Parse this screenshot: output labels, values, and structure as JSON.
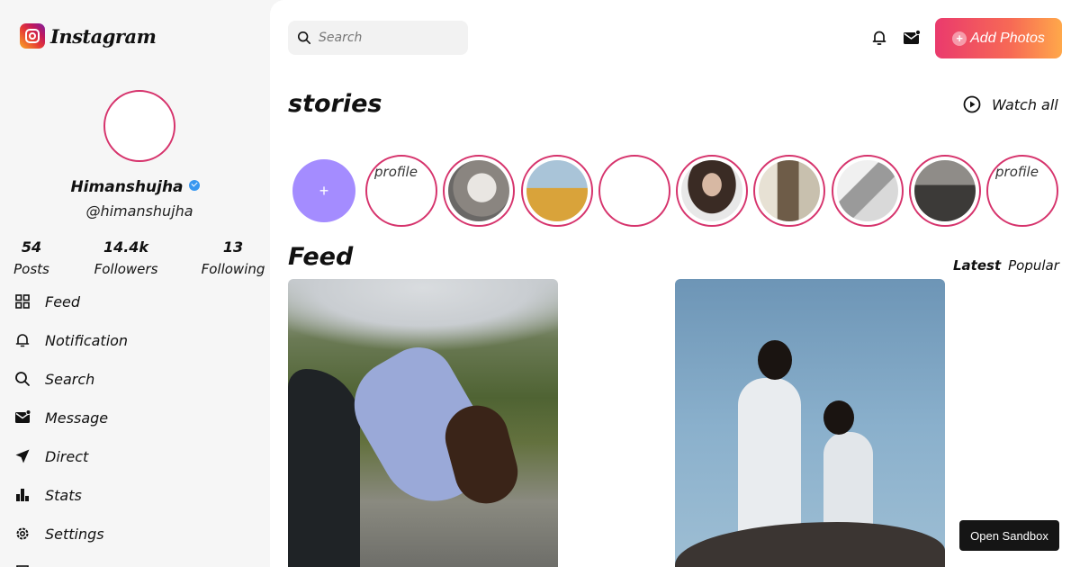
{
  "app": {
    "logo_text": "Instagram"
  },
  "profile": {
    "name": "Himanshujha",
    "handle": "@himanshujha",
    "stats": [
      {
        "value": "54",
        "label": "Posts"
      },
      {
        "value": "14.4k",
        "label": "Followers"
      },
      {
        "value": "13",
        "label": "Following"
      }
    ]
  },
  "nav": [
    {
      "label": "Feed",
      "icon": "grid-icon"
    },
    {
      "label": "Notification",
      "icon": "bell-icon"
    },
    {
      "label": "Search",
      "icon": "search-icon"
    },
    {
      "label": "Message",
      "icon": "mail-icon"
    },
    {
      "label": "Direct",
      "icon": "send-icon"
    },
    {
      "label": "Stats",
      "icon": "bar-chart-icon"
    },
    {
      "label": "Settings",
      "icon": "gear-icon"
    }
  ],
  "topbar": {
    "search_placeholder": "Search",
    "add_photos_label": "Add Photos",
    "add_symbol": "+"
  },
  "stories": {
    "title": "stories",
    "watch_all_label": "Watch all",
    "add_label": "+",
    "broken_alt": "profile",
    "items": [
      {
        "kind": "broken"
      },
      {
        "kind": "photo",
        "color": "#8a8580"
      },
      {
        "kind": "photo",
        "color": "#c9a040"
      },
      {
        "kind": "empty"
      },
      {
        "kind": "photo",
        "color": "#6f5a4c"
      },
      {
        "kind": "photo",
        "color": "#8a7b62"
      },
      {
        "kind": "photo",
        "color": "#bfbfbf"
      },
      {
        "kind": "photo",
        "color": "#4a4846"
      },
      {
        "kind": "broken"
      }
    ]
  },
  "feed": {
    "title": "Feed",
    "tabs": [
      {
        "label": "Latest",
        "active": true
      },
      {
        "label": "Popular",
        "active": false
      }
    ]
  },
  "sandbox": {
    "label": "Open Sandbox"
  },
  "colors": {
    "accent": "#d6336c",
    "add_story": "#a48cff",
    "verified": "#3897f0"
  }
}
